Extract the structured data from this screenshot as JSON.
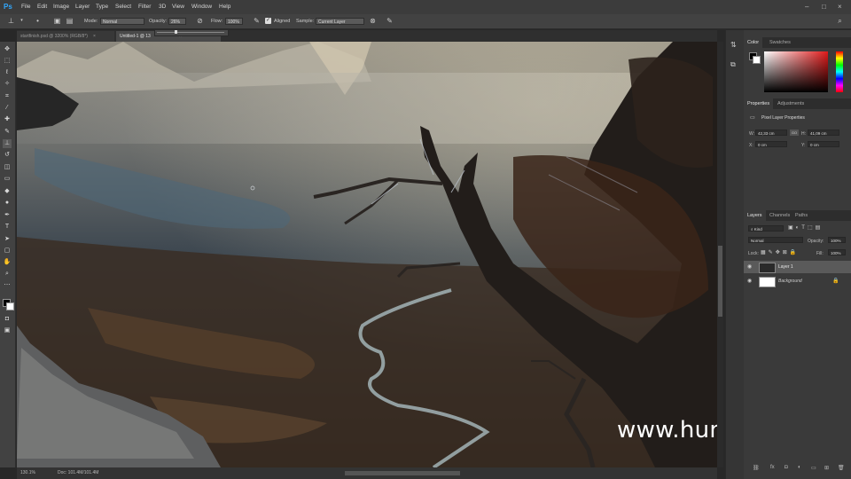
{
  "app": {
    "logo": "Ps"
  },
  "menu": [
    "File",
    "Edit",
    "Image",
    "Layer",
    "Type",
    "Select",
    "Filter",
    "3D",
    "View",
    "Window",
    "Help"
  ],
  "options": {
    "mode_label": "Mode:",
    "mode_value": "Normal",
    "opacity_label": "Opacity:",
    "opacity_value": "26%",
    "flow_label": "Flow:",
    "flow_value": "100%",
    "aligned_label": "Aligned",
    "sample_label": "Sample:",
    "sample_value": "Current Layer"
  },
  "tabs": [
    {
      "label": "startfinish.psd @ 3200% (RGB/8*)",
      "close": "×"
    },
    {
      "label": "Untitled-1 @ 13",
      "close": "×"
    }
  ],
  "status": {
    "zoom": "130.1%",
    "doc": "Doc: 101.4M/101.4M"
  },
  "watermark": "www.hunls.com",
  "color_panel": {
    "tabs": [
      "Color",
      "Swatches"
    ]
  },
  "properties": {
    "tabs": [
      "Properties",
      "Adjustments"
    ],
    "title": "Pixel Layer Properties",
    "w_label": "W:",
    "w_value": "42,33 cm",
    "h_label": "H:",
    "h_value": "41,09 cm",
    "x_label": "X:",
    "x_value": "0 cm",
    "y_label": "Y:",
    "y_value": "0 cm",
    "link_label": "GO"
  },
  "layers_panel": {
    "tabs": [
      "Layers",
      "Channels",
      "Paths"
    ],
    "filter_value": "Kind",
    "blend_value": "Normal",
    "opacity_label": "Opacity:",
    "opacity_value": "100%",
    "lock_label": "Lock:",
    "fill_label": "Fill:",
    "fill_value": "100%",
    "layers": [
      {
        "name": "Layer 1",
        "selected": true
      },
      {
        "name": "Background",
        "selected": false
      }
    ]
  },
  "colors": {
    "accent": "#31a8ff",
    "selected_layer": "#5a5a5a"
  }
}
